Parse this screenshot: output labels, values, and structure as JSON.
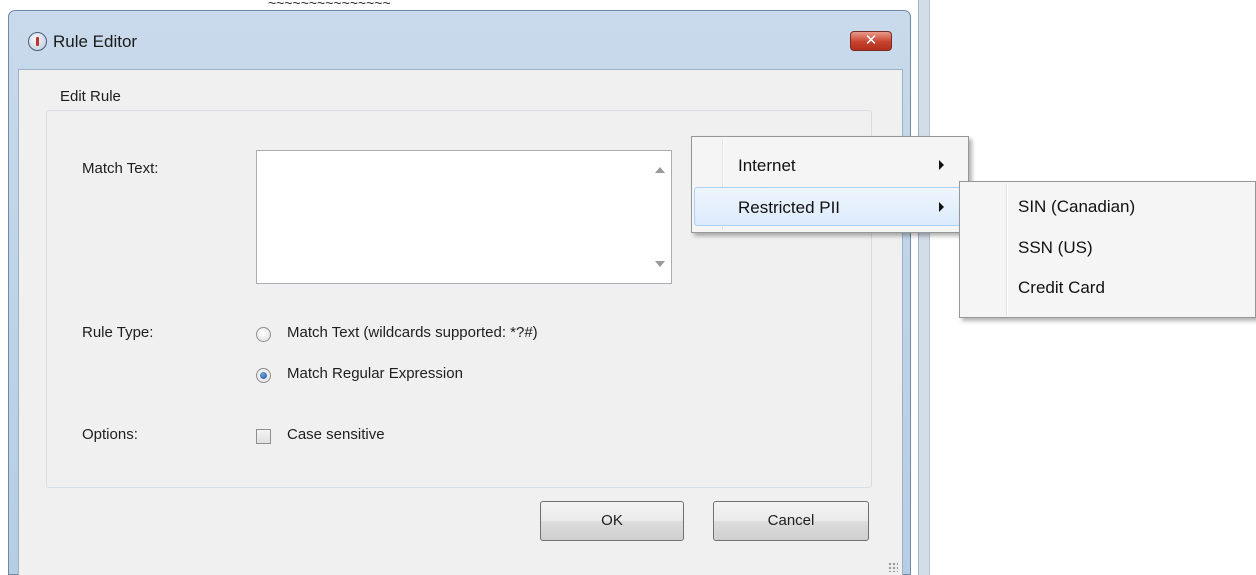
{
  "window": {
    "title": "Rule Editor",
    "close_glyph": "✕"
  },
  "group": {
    "legend": "Edit Rule"
  },
  "match_text": {
    "label": "Match Text:",
    "value": ""
  },
  "rule_type": {
    "label": "Rule Type:",
    "options": [
      {
        "label": "Match Text (wildcards supported: *?#)",
        "checked": false
      },
      {
        "label": "Match Regular Expression",
        "checked": true
      }
    ]
  },
  "options": {
    "label": "Options:",
    "case_sensitive": {
      "label": "Case sensitive",
      "checked": false
    }
  },
  "buttons": {
    "ok": "OK",
    "cancel": "Cancel"
  },
  "context_menu": {
    "items": [
      {
        "label": "Internet",
        "has_submenu": true,
        "highlighted": false
      },
      {
        "label": "Restricted PII",
        "has_submenu": true,
        "highlighted": true
      }
    ]
  },
  "submenu": {
    "items": [
      {
        "label": "SIN (Canadian)"
      },
      {
        "label": "SSN (US)"
      },
      {
        "label": "Credit Card"
      }
    ]
  },
  "colors": {
    "titlebar": "#c8daeb",
    "close_button": "#c8432f",
    "menu_highlight": "#dcebfc",
    "dialog_background": "#f0f0f0"
  },
  "icons": [
    "app-icon",
    "close-icon",
    "scroll-up-icon",
    "scroll-down-icon",
    "submenu-arrow-icon",
    "resize-grip-icon"
  ]
}
